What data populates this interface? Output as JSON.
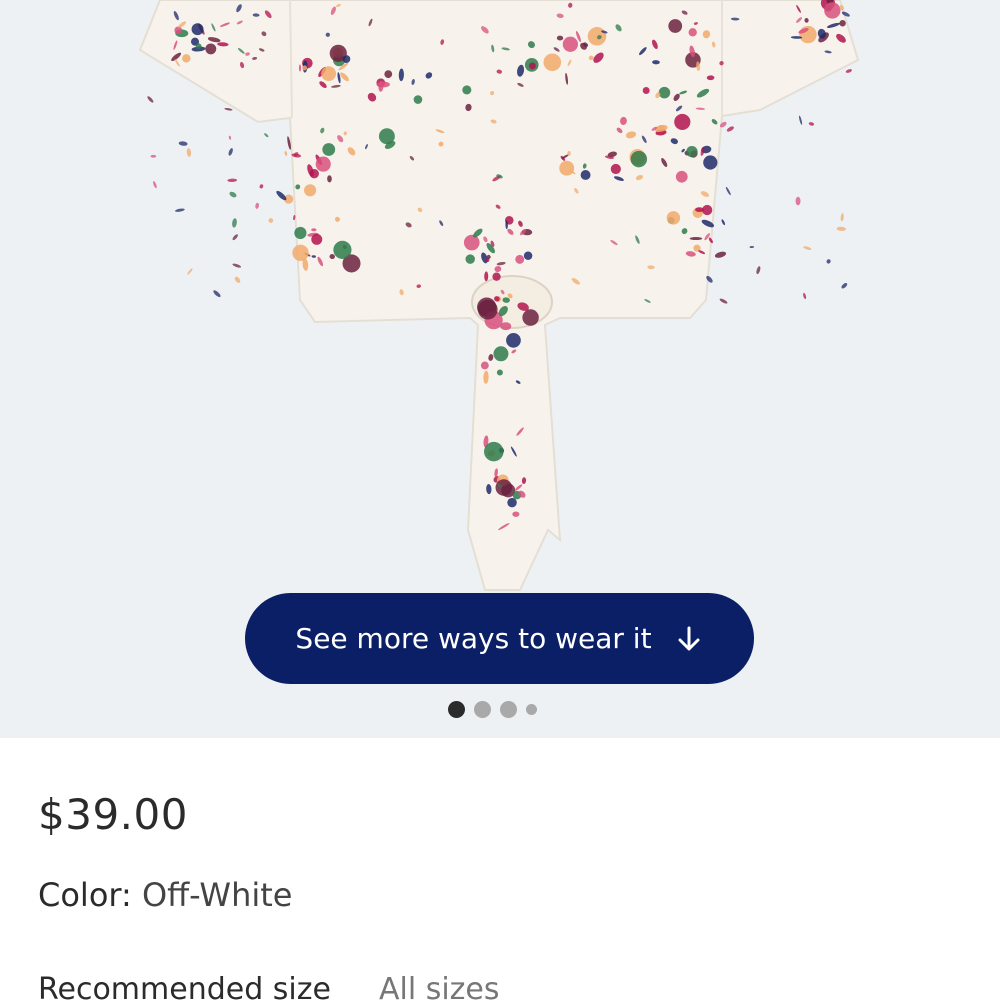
{
  "hero": {
    "cta_label": "See more ways to wear it",
    "cta_icon": "arrow-down-icon",
    "carousel": {
      "count": 4,
      "active_index": 0
    }
  },
  "product": {
    "price": "$39.00",
    "color_label": "Color:",
    "color_value": "Off-White"
  },
  "size_tabs": {
    "recommended": "Recommended size",
    "all": "All sizes"
  },
  "colors": {
    "hero_bg": "#eef1f3",
    "cta_bg": "#0b1f66",
    "fabric": "#f7f3ec",
    "floral_magenta": "#b3134f",
    "floral_navy": "#1f2a6b",
    "floral_peach": "#f2a96b",
    "floral_green": "#2f7a4b"
  }
}
